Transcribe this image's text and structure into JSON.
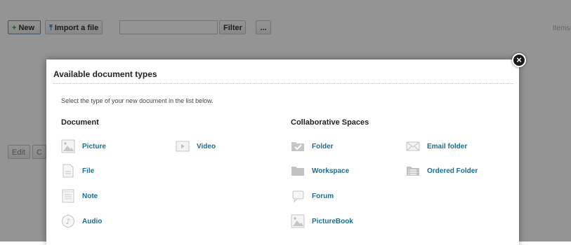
{
  "toolbar": {
    "new_label": "New",
    "import_label": "Import a file",
    "filter_placeholder": "",
    "filter_label": "Filter",
    "more_label": "...",
    "items_label": "Items/",
    "edit_label": "Edit",
    "c_label": "C"
  },
  "modal": {
    "title": "Available document types",
    "instructions": "Select the type of your new document in the list below.",
    "close_label": "×",
    "document_section": {
      "title": "Document",
      "items": [
        {
          "label": "Picture",
          "icon": "picture-icon"
        },
        {
          "label": "Video",
          "icon": "video-icon"
        },
        {
          "label": "File",
          "icon": "file-icon"
        },
        {
          "label": "Note",
          "icon": "note-icon"
        },
        {
          "label": "Audio",
          "icon": "audio-icon"
        }
      ]
    },
    "collab_section": {
      "title": "Collaborative Spaces",
      "items": [
        {
          "label": "Folder",
          "icon": "folder-icon"
        },
        {
          "label": "Email folder",
          "icon": "email-folder-icon"
        },
        {
          "label": "Workspace",
          "icon": "workspace-icon"
        },
        {
          "label": "Ordered Folder",
          "icon": "ordered-folder-icon"
        },
        {
          "label": "Forum",
          "icon": "forum-icon"
        },
        {
          "label": "PictureBook",
          "icon": "picturebook-icon"
        }
      ]
    }
  },
  "colors": {
    "link": "#1a6e91",
    "overlay": "rgba(0,0,0,0.42)",
    "new_plus": "#3b9a3b"
  }
}
